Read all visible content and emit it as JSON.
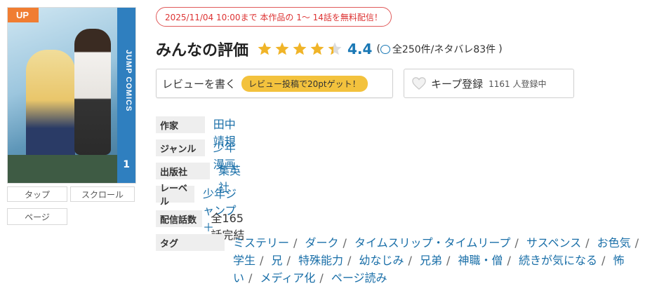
{
  "cover": {
    "badge": "UP",
    "spine_text": "JUMP COMICS",
    "volume": "1"
  },
  "side_buttons": [
    "タップ",
    "スクロール",
    "ページ"
  ],
  "notice": "2025/11/04 10:00まで 本作品の 1～ 14話を無料配信！",
  "rating": {
    "title": "みんなの評価",
    "score": "4.4",
    "stars": 4.4,
    "open": "(",
    "reviews": "全250件/ネタバレ83件",
    "close": ")",
    "star_color": "#f0b428"
  },
  "review_button": {
    "label": "レビューを書く",
    "badge": "レビュー投稿で20ptゲット！"
  },
  "keep_button": {
    "label": "キープ登録",
    "count": "1161 人登録中"
  },
  "info": {
    "author": {
      "label": "作家",
      "value": "田中靖規"
    },
    "genre": {
      "label": "ジャンル",
      "value": "少年漫画"
    },
    "publisher": {
      "label": "出版社",
      "value": "集英社"
    },
    "label": {
      "label": "レーベル",
      "value": "少年ジャンプ＋"
    },
    "episodes": {
      "label": "配信話数",
      "value": "全165話完結"
    },
    "tags": {
      "label": "タグ",
      "separator": "/",
      "items": [
        "ミステリー",
        "ダーク",
        "タイムスリップ・タイムリープ",
        "サスペンス",
        "お色気",
        "学生",
        "兄",
        "特殊能力",
        "幼なじみ",
        "兄弟",
        "神職・僧",
        "続きが気になる",
        "怖い",
        "メディア化",
        "ページ読み"
      ]
    }
  }
}
